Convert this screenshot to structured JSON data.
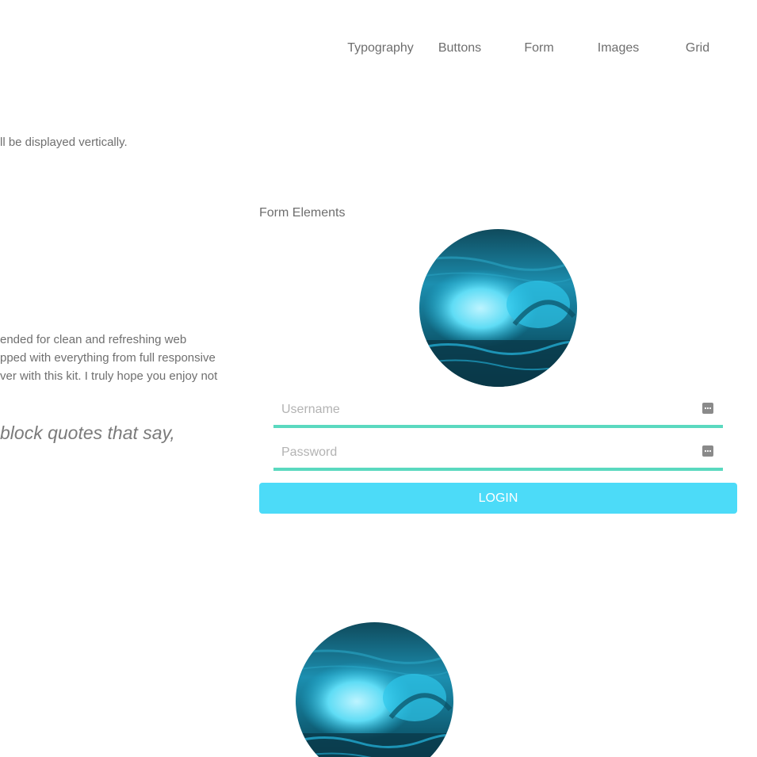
{
  "nav": {
    "items": [
      {
        "label": "Typography"
      },
      {
        "label": "Buttons"
      },
      {
        "label": "Form"
      },
      {
        "label": "Images"
      },
      {
        "label": "Grid"
      }
    ]
  },
  "left": {
    "intro": "ll be displayed vertically.",
    "paragraph_lines": [
      "ended for clean and refreshing web",
      "pped with everything from full responsive",
      "ver with this kit. I truly hope you enjoy not"
    ],
    "quote": "block quotes that say,"
  },
  "form": {
    "title": "Form Elements",
    "username": {
      "placeholder": "Username",
      "value": "",
      "icon": "credential-icon"
    },
    "password": {
      "placeholder": "Password",
      "value": "",
      "icon": "credential-icon"
    },
    "login_label": "LOGIN"
  },
  "images": {
    "top_avatar": "ocean-wave-image",
    "bottom_avatar": "ocean-wave-image"
  },
  "colors": {
    "accent": "#4cdbf8",
    "field_underline": "#5ad9bf",
    "text": "#6e6e6e"
  }
}
